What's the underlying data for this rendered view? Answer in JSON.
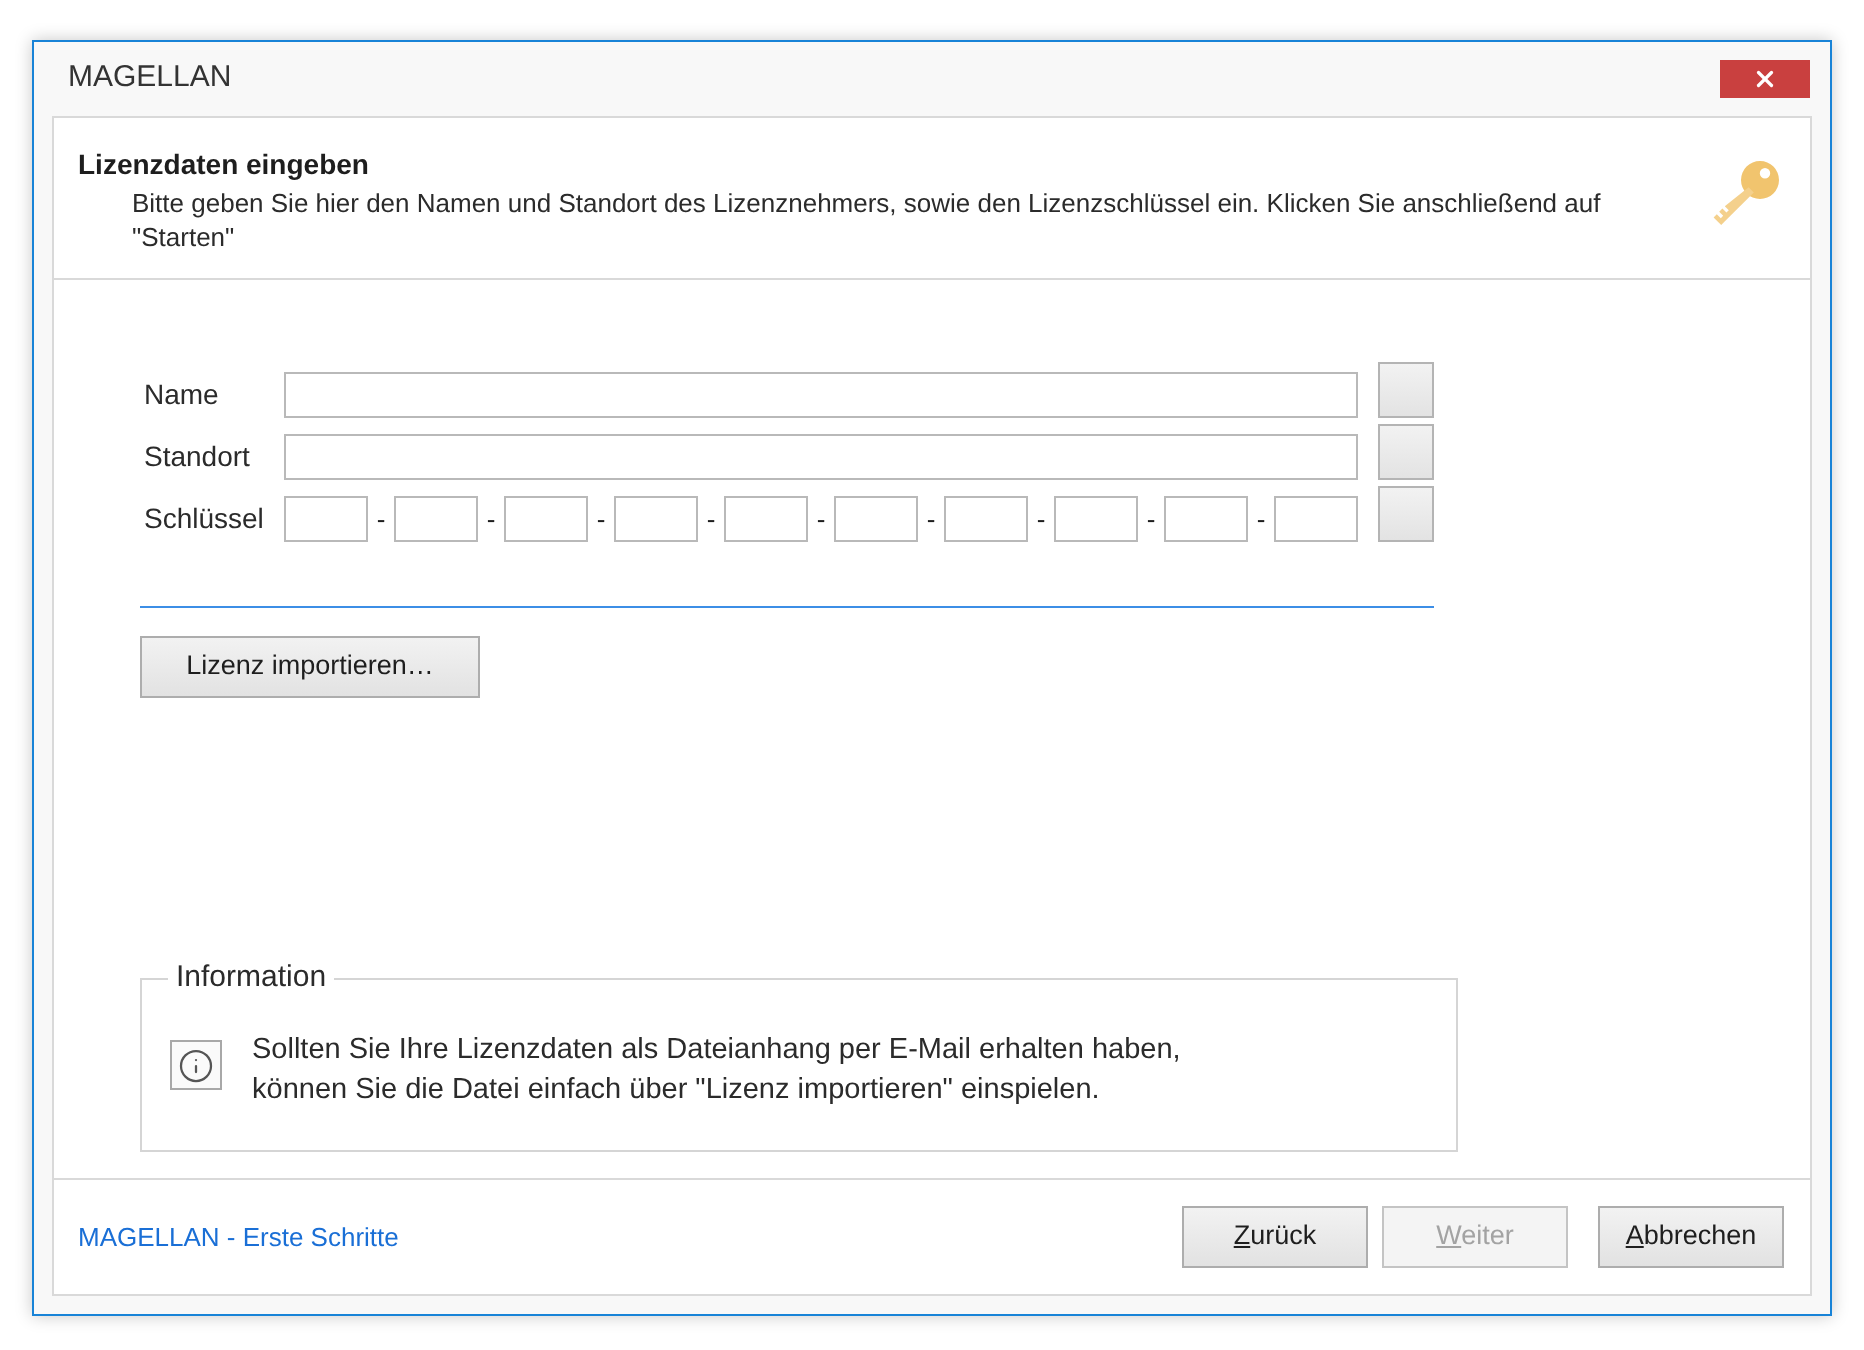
{
  "window": {
    "title": "MAGELLAN"
  },
  "header": {
    "title": "Lizenzdaten eingeben",
    "description": "Bitte geben Sie hier den Namen und Standort des Lizenznehmers, sowie den Lizenzschlüssel ein. Klicken Sie anschließend auf \"Starten\""
  },
  "form": {
    "fields": [
      {
        "label": "Name",
        "kind": "text"
      },
      {
        "label": "Standort",
        "kind": "text"
      },
      {
        "label": "Schlüssel",
        "kind": "key",
        "parts": [
          {
            "kind": "box"
          },
          {
            "kind": "separator",
            "text": "-"
          },
          {
            "kind": "box"
          },
          {
            "kind": "separator",
            "text": "-"
          },
          {
            "kind": "box"
          },
          {
            "kind": "separator",
            "text": "-"
          },
          {
            "kind": "box"
          },
          {
            "kind": "separator",
            "text": "-"
          },
          {
            "kind": "box"
          },
          {
            "kind": "separator",
            "text": "-"
          },
          {
            "kind": "box"
          },
          {
            "kind": "separator",
            "text": "-"
          },
          {
            "kind": "box"
          },
          {
            "kind": "separator",
            "text": "-"
          },
          {
            "kind": "box"
          },
          {
            "kind": "separator",
            "text": "-"
          },
          {
            "kind": "box"
          },
          {
            "kind": "separator",
            "text": "-"
          },
          {
            "kind": "box"
          }
        ]
      }
    ]
  },
  "import_button": {
    "label": "Lizenz importieren…"
  },
  "information": {
    "title": "Information",
    "text": "Sollten Sie Ihre Lizenzdaten als Dateianhang per E-Mail erhalten haben,\nkönnen Sie die Datei einfach über \"Lizenz importieren\" einspielen."
  },
  "footer": {
    "link": "MAGELLAN - Erste Schritte",
    "buttons": [
      {
        "label": "Zurück",
        "disabled": false,
        "mnemonic_underlined": true
      },
      {
        "label": "Weiter",
        "disabled": true,
        "mnemonic_underlined": true
      },
      {
        "label": "Abbrechen",
        "disabled": false,
        "mnemonic_underlined": true
      }
    ]
  }
}
